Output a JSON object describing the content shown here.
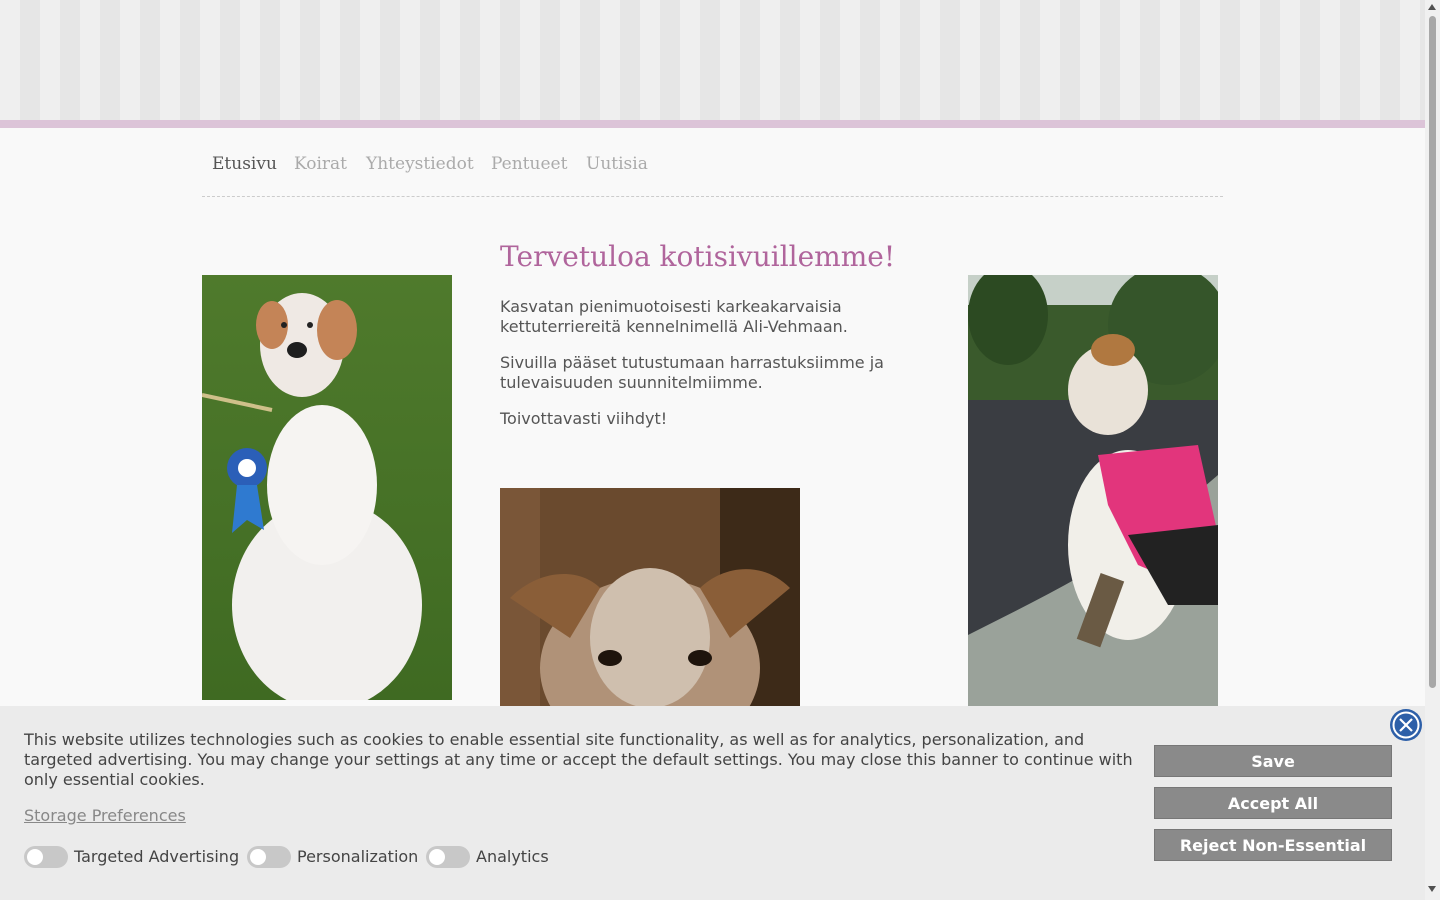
{
  "nav": {
    "items": [
      {
        "label": "Etusivu",
        "active": true
      },
      {
        "label": "Koirat"
      },
      {
        "label": "Yhteystiedot"
      },
      {
        "label": "Pentueet"
      },
      {
        "label": "Uutisia"
      }
    ]
  },
  "main": {
    "heading": "Tervetuloa kotisivuillemme!",
    "paragraphs": [
      "Kasvatan pienimuotoisesti karkeakarvaisia kettuterriereitä kennelnimellä Ali-Vehmaan.",
      "Sivuilla pääset tutustumaan harrastuksiimme ja tulevaisuuden suunnitelmiimme.",
      "Toivottavasti viihdyt!"
    ]
  },
  "cookie_banner": {
    "text": "This website utilizes technologies such as cookies to enable essential site functionality, as well as for analytics, personalization, and targeted advertising. You may change your settings at any time or accept the default settings. You may close this banner to continue with only essential cookies.",
    "preferences_link": "Storage Preferences",
    "toggles": [
      {
        "label": "Targeted Advertising",
        "on": false
      },
      {
        "label": "Personalization",
        "on": false
      },
      {
        "label": "Analytics",
        "on": false
      }
    ],
    "buttons": {
      "save": "Save",
      "accept_all": "Accept All",
      "reject": "Reject Non-Essential"
    }
  },
  "colors": {
    "heading": "#b0659c",
    "header_bar": "#dcc4d8",
    "button": "#8a8a8a",
    "close_button": "#2d5fa8"
  }
}
